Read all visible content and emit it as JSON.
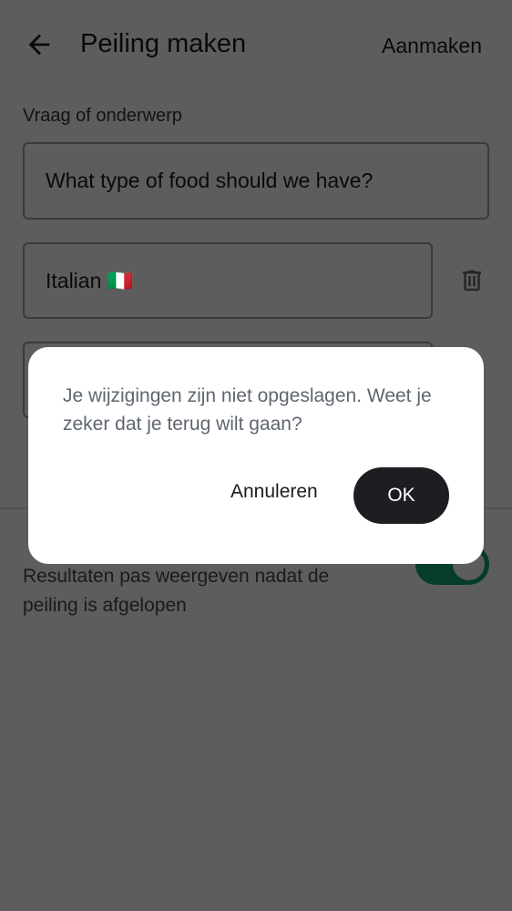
{
  "header": {
    "title": "Peiling maken",
    "create_label": "Aanmaken"
  },
  "form": {
    "question_label": "Vraag of onderwerp",
    "question_value": "What type of food should we have?",
    "options": [
      "Italian 🇮🇹",
      ""
    ],
    "results_description": "Resultaten pas weergeven nadat de peiling is afgelopen",
    "results_toggle_on": true
  },
  "dialog": {
    "message": "Je wijzigingen zijn niet opgeslagen. Weet je zeker dat je terug wilt gaan?",
    "cancel_label": "Annuleren",
    "ok_label": "OK"
  },
  "colors": {
    "toggle": "#0f6b47",
    "ok_button": "#1c1e22"
  }
}
